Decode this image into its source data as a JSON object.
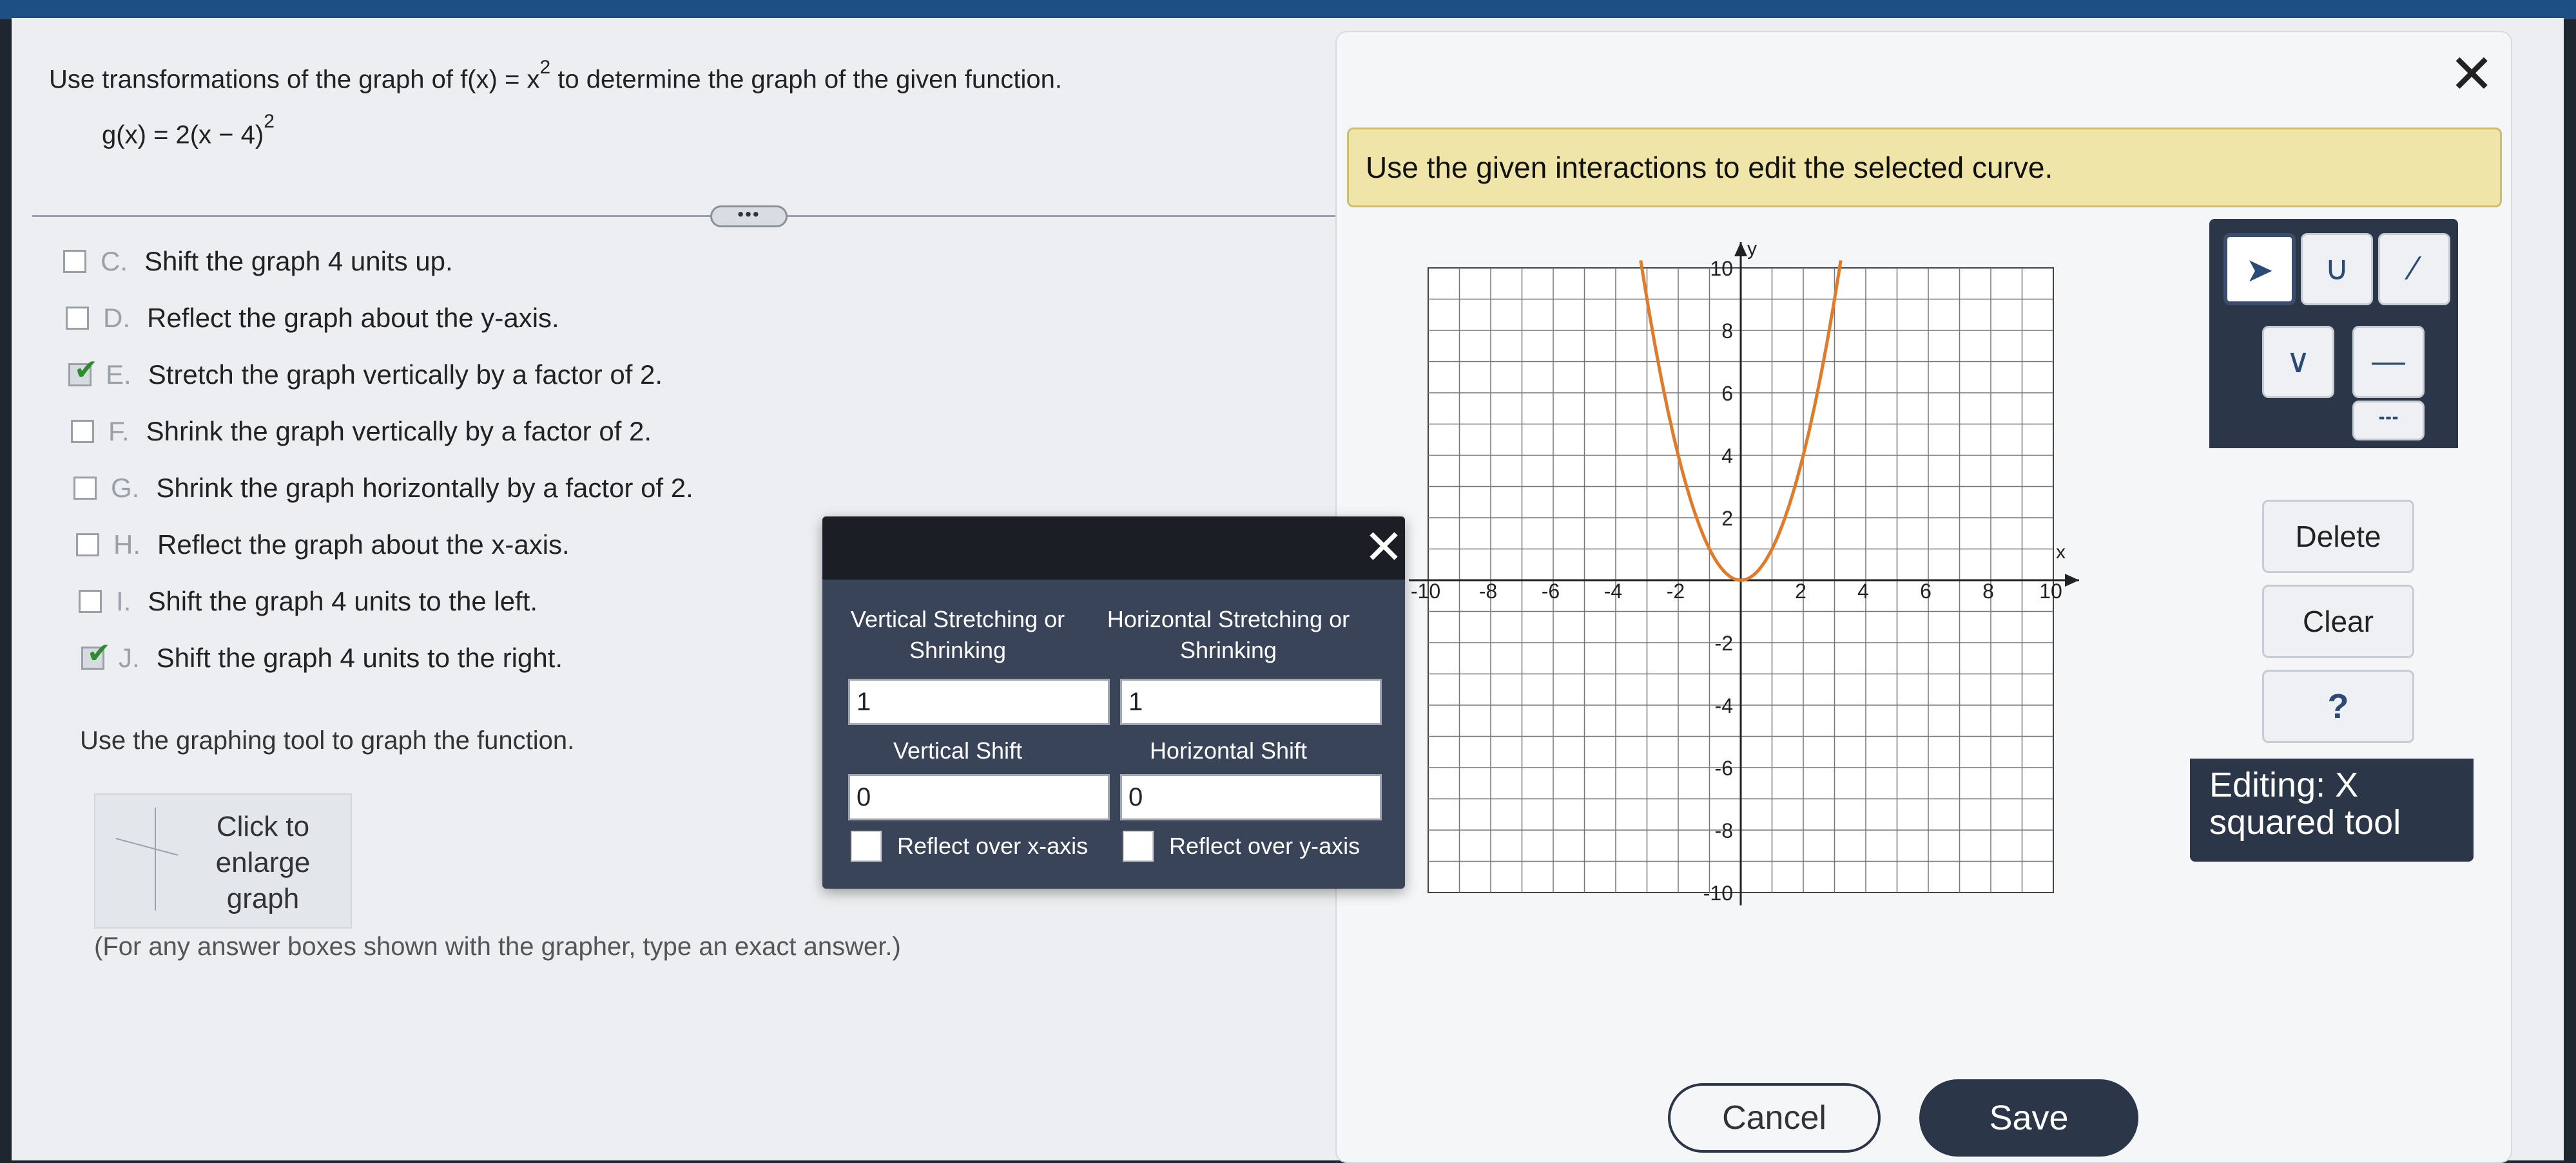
{
  "question": {
    "prompt_prefix": "Use transformations of the graph of f(x) = x",
    "prompt_exponent": "2",
    "prompt_suffix": " to determine the graph of the given function.",
    "function_base": "g(x) = 2(x − 4)",
    "function_exponent": "2",
    "more_label": "•••"
  },
  "options": [
    {
      "letter": "C.",
      "text": "Shift the graph 4 units up.",
      "checked": false
    },
    {
      "letter": "D.",
      "text": "Reflect the graph about the y-axis.",
      "checked": false
    },
    {
      "letter": "E.",
      "text": "Stretch the graph vertically by a factor of 2.",
      "checked": true
    },
    {
      "letter": "F.",
      "text": "Shrink the graph vertically by a factor of 2.",
      "checked": false
    },
    {
      "letter": "G.",
      "text": "Shrink the graph horizontally by a factor of 2.",
      "checked": false
    },
    {
      "letter": "H.",
      "text": "Reflect the graph about the x-axis.",
      "checked": false
    },
    {
      "letter": "I.",
      "text": "Shift the graph 4 units to the left.",
      "checked": false
    },
    {
      "letter": "J.",
      "text": "Shift the graph 4 units to the right.",
      "checked": true
    }
  ],
  "graph_instruction": "Use the graphing tool to graph the function.",
  "enlarge_label": "Click to enlarge graph",
  "hint": "(For any answer boxes shown with the grapher, type an exact answer.)",
  "panel": {
    "banner": "Use the given interactions to edit the selected curve.",
    "close_icon": "✕"
  },
  "graph": {
    "x_label": "x",
    "y_label": "y",
    "x_ticks": [
      "-10",
      "-8",
      "-6",
      "-4",
      "-2",
      "2",
      "4",
      "6",
      "8",
      "10"
    ],
    "y_ticks": [
      "10",
      "8",
      "6",
      "4",
      "2",
      "-2",
      "-4",
      "-6",
      "-8",
      "-10"
    ],
    "curve_color": "#e07b2a"
  },
  "toolbar": {
    "tools": [
      "pointer",
      "parabola",
      "square-root"
    ],
    "tools2": [
      "absolute-value",
      "line-solid",
      "line-dashed"
    ],
    "delete_label": "Delete",
    "clear_label": "Clear",
    "help_label": "?",
    "editing_label": "Editing: X squared tool"
  },
  "dialog": {
    "close_icon": "✕",
    "vert_stretch_label": "Vertical Stretching or Shrinking",
    "horiz_stretch_label": "Horizontal Stretching or Shrinking",
    "vert_stretch_value": "1",
    "horiz_stretch_value": "1",
    "vert_shift_label": "Vertical Shift",
    "horiz_shift_label": "Horizontal Shift",
    "vert_shift_value": "0",
    "horiz_shift_value": "0",
    "reflect_x_label": "Reflect over x-axis",
    "reflect_y_label": "Reflect over y-axis"
  },
  "footer": {
    "cancel_label": "Cancel",
    "save_label": "Save"
  }
}
